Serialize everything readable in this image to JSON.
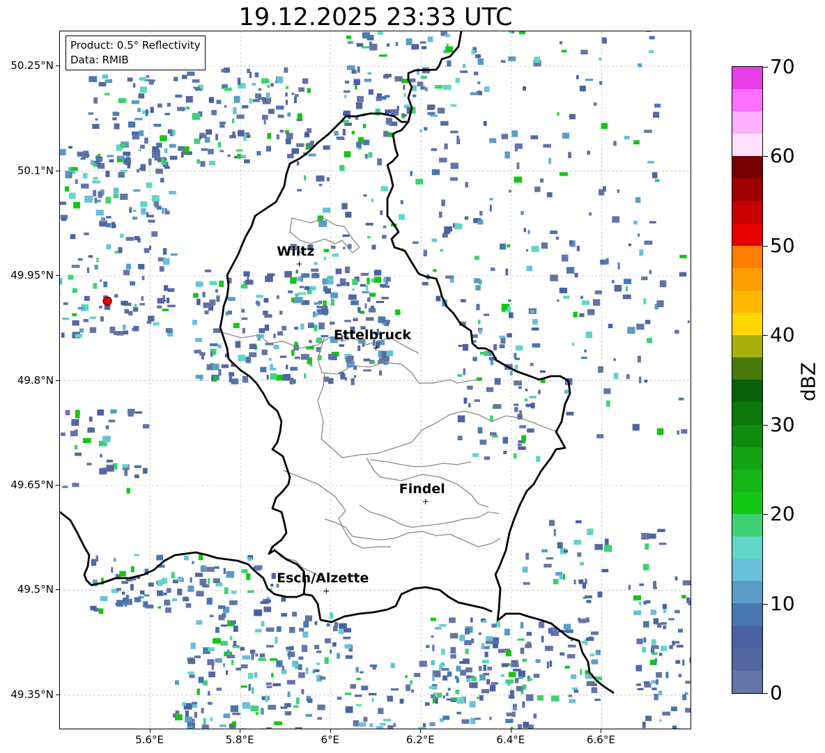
{
  "title": "19.12.2025 23:33 UTC",
  "info": {
    "product": "Product: 0.5° Reflectivity",
    "source": "Data: RMIB"
  },
  "map": {
    "lon_range": [
      5.4,
      6.8
    ],
    "lat_range": [
      49.3,
      50.3
    ],
    "lat_ticks": [
      {
        "label": "50.25°N",
        "value": 50.25
      },
      {
        "label": "50.1°N",
        "value": 50.1
      },
      {
        "label": "49.95°N",
        "value": 49.95
      },
      {
        "label": "49.8°N",
        "value": 49.8
      },
      {
        "label": "49.65°N",
        "value": 49.65
      },
      {
        "label": "49.5°N",
        "value": 49.5
      },
      {
        "label": "49.35°N",
        "value": 49.35
      }
    ],
    "lon_ticks": [
      {
        "label": "5.6°E",
        "value": 5.6
      },
      {
        "label": "5.8°E",
        "value": 5.8
      },
      {
        "label": "6°E",
        "value": 6.0
      },
      {
        "label": "6.2°E",
        "value": 6.2
      },
      {
        "label": "6.4°E",
        "value": 6.4
      },
      {
        "label": "6.6°E",
        "value": 6.6
      }
    ],
    "gridlines": true,
    "cities": [
      {
        "name": "Wiltz",
        "lon": 5.93,
        "lat": 49.967
      },
      {
        "name": "Ettelbruck",
        "lon": 6.1,
        "lat": 49.847
      },
      {
        "name": "Findel",
        "lon": 6.21,
        "lat": 49.627
      },
      {
        "name": "Esch/Alzette",
        "lon": 5.99,
        "lat": 49.499
      }
    ],
    "radar_site": {
      "lon": 5.505,
      "lat": 49.914,
      "color": "#e00000"
    }
  },
  "colorbar": {
    "label": "dBZ",
    "min": 0,
    "max": 70,
    "ticks": [
      {
        "label": "0",
        "value": 0
      },
      {
        "label": "10",
        "value": 10
      },
      {
        "label": "20",
        "value": 20
      },
      {
        "label": "30",
        "value": 30
      },
      {
        "label": "40",
        "value": 40
      },
      {
        "label": "50",
        "value": 50
      },
      {
        "label": "60",
        "value": 60
      },
      {
        "label": "70",
        "value": 70
      }
    ],
    "colors": [
      "#6474a6",
      "#5468a0",
      "#4a62a4",
      "#4978b0",
      "#5a9cc6",
      "#68c0da",
      "#60d6c6",
      "#3ed274",
      "#14c614",
      "#16b416",
      "#12a212",
      "#0e8c0e",
      "#0c780c",
      "#0a600a",
      "#48780a",
      "#aab00a",
      "#ffd700",
      "#ffb800",
      "#ff9e00",
      "#ff7e00",
      "#e60000",
      "#c80000",
      "#a00000",
      "#780000",
      "#ffe0ff",
      "#ffb0ff",
      "#ff70ff",
      "#e83ce8"
    ]
  }
}
